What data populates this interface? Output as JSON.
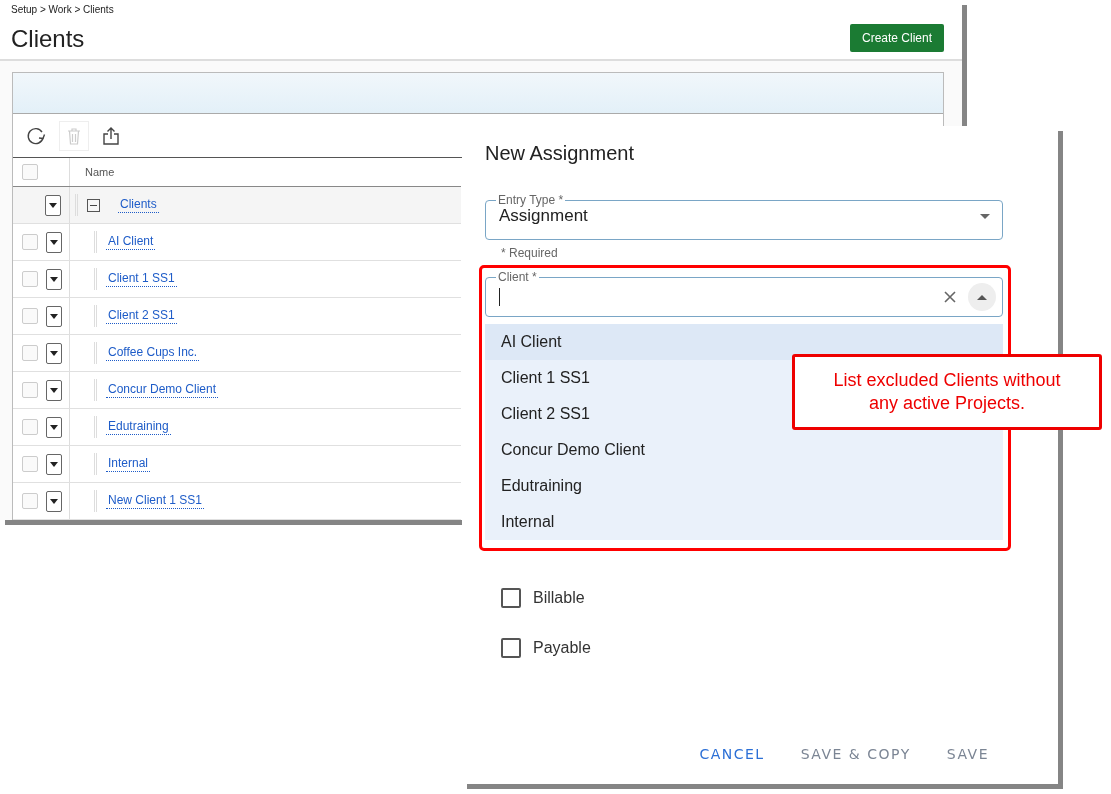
{
  "breadcrumb": "Setup > Work > Clients",
  "page_title": "Clients",
  "create_button": "Create Client",
  "grid": {
    "columns": [
      "Name"
    ],
    "select_all_checked": false,
    "group": {
      "label": "Clients",
      "expanded": true
    },
    "rows": [
      {
        "name": "AI Client",
        "checked": false
      },
      {
        "name": "Client 1 SS1",
        "checked": false
      },
      {
        "name": "Client 2 SS1",
        "checked": false
      },
      {
        "name": "Coffee Cups Inc.",
        "checked": false
      },
      {
        "name": "Concur Demo Client",
        "checked": false
      },
      {
        "name": "Edutraining",
        "checked": false
      },
      {
        "name": "Internal",
        "checked": false
      },
      {
        "name": "New Client 1 SS1",
        "checked": false
      }
    ]
  },
  "dialog": {
    "title": "New Assignment",
    "entry_type": {
      "label": "Entry Type *",
      "value": "Assignment",
      "hint": "* Required"
    },
    "client": {
      "label": "Client *",
      "options": [
        {
          "label": "AI Client",
          "selected": true
        },
        {
          "label": "Client 1 SS1",
          "selected": false
        },
        {
          "label": "Client 2 SS1",
          "selected": false
        },
        {
          "label": "Concur Demo Client",
          "selected": false
        },
        {
          "label": "Edutraining",
          "selected": false
        },
        {
          "label": "Internal",
          "selected": false
        }
      ]
    },
    "checkboxes": [
      {
        "label": "Billable",
        "checked": false
      },
      {
        "label": "Payable",
        "checked": false
      }
    ],
    "buttons": [
      {
        "label": "CANCEL",
        "kind": "primary"
      },
      {
        "label": "SAVE & COPY",
        "kind": "muted"
      },
      {
        "label": "SAVE",
        "kind": "muted"
      }
    ]
  },
  "callout": "List excluded Clients without any active Projects."
}
